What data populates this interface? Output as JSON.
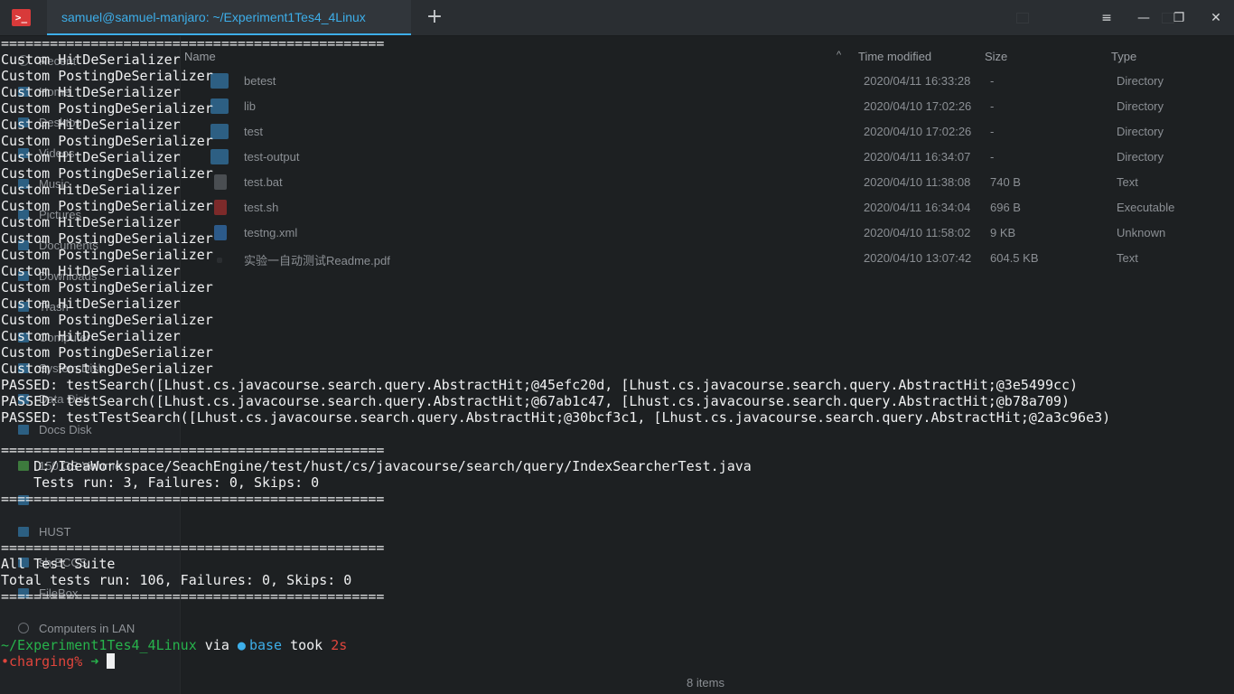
{
  "window": {
    "app_icon_glyph": ">_",
    "tab_title": "samuel@samuel-manjaro: ~/Experiment1Tes4_4Linux",
    "new_tab_glyph": "+",
    "menu_glyph": "≡",
    "minimize_glyph": "—",
    "maximize_glyph": "❐",
    "close_glyph": "✕",
    "accent_color": "#3daee9"
  },
  "file_manager": {
    "sidebar": [
      {
        "label": "Recent",
        "icon": "clock-icon"
      },
      {
        "label": "Home",
        "icon": "home-icon"
      },
      {
        "label": "Desktop",
        "icon": "folder-icon"
      },
      {
        "label": "Videos",
        "icon": "folder-icon"
      },
      {
        "label": "Music",
        "icon": "folder-icon"
      },
      {
        "label": "Pictures",
        "icon": "folder-icon"
      },
      {
        "label": "Documents",
        "icon": "folder-icon"
      },
      {
        "label": "Downloads",
        "icon": "folder-icon"
      },
      {
        "label": "Trash",
        "icon": "trash-icon"
      },
      {
        "label": "Computer",
        "icon": "computer-icon"
      },
      {
        "label": "System Disk",
        "icon": "disk-icon"
      },
      {
        "label": "Data Disk",
        "icon": "disk-icon"
      },
      {
        "label": "Docs Disk",
        "icon": "disk-icon"
      },
      {
        "label": "150 GB Volume",
        "icon": "drive-icon"
      },
      {
        "label": "",
        "icon": "folder-icon"
      },
      {
        "label": "HUST",
        "icon": "folder-icon"
      },
      {
        "label": "sh.ECCS",
        "icon": "folder-icon"
      },
      {
        "label": "FileBox",
        "icon": "folder-icon"
      },
      {
        "label": "Computers in LAN",
        "icon": "network-icon"
      }
    ],
    "columns": [
      "Name",
      "Time modified",
      "Size",
      "Type"
    ],
    "files": [
      {
        "name": "betest",
        "time": "2020/04/11 16:33:28",
        "size": "-",
        "type": "Directory",
        "icon": "folder-icon"
      },
      {
        "name": "lib",
        "time": "2020/04/10 17:02:26",
        "size": "-",
        "type": "Directory",
        "icon": "folder-icon"
      },
      {
        "name": "test",
        "time": "2020/04/10 17:02:26",
        "size": "-",
        "type": "Directory",
        "icon": "folder-icon"
      },
      {
        "name": "test-output",
        "time": "2020/04/11 16:34:07",
        "size": "-",
        "type": "Directory",
        "icon": "folder-icon"
      },
      {
        "name": "test.bat",
        "time": "2020/04/10 11:38:08",
        "size": "740 B",
        "type": "Text",
        "icon": "text-file-icon"
      },
      {
        "name": "test.sh",
        "time": "2020/04/11 16:34:04",
        "size": "696 B",
        "type": "Executable",
        "icon": "script-file-icon"
      },
      {
        "name": "testng.xml",
        "time": "2020/04/10 11:58:02",
        "size": "9 KB",
        "type": "Unknown",
        "icon": "xml-file-icon"
      },
      {
        "name": "实验一自动测试Readme.pdf",
        "time": "2020/04/10 13:07:42",
        "size": "604.5 KB",
        "type": "Text",
        "icon": "pdf-file-icon"
      }
    ],
    "status": "8 items"
  },
  "terminal": {
    "lines": [
      "===============================================",
      "Custom HitDeSerializer",
      "Custom PostingDeSerializer",
      "Custom HitDeSerializer",
      "Custom PostingDeSerializer",
      "Custom HitDeSerializer",
      "Custom PostingDeSerializer",
      "Custom HitDeSerializer",
      "Custom PostingDeSerializer",
      "Custom HitDeSerializer",
      "Custom PostingDeSerializer",
      "Custom HitDeSerializer",
      "Custom PostingDeSerializer",
      "Custom PostingDeSerializer",
      "Custom HitDeSerializer",
      "Custom PostingDeSerializer",
      "Custom HitDeSerializer",
      "Custom PostingDeSerializer",
      "Custom HitDeSerializer",
      "Custom PostingDeSerializer",
      "Custom PostingDeSerializer",
      "PASSED: testSearch([Lhust.cs.javacourse.search.query.AbstractHit;@45efc20d, [Lhust.cs.javacourse.search.query.AbstractHit;@3e5499cc)",
      "PASSED: testSearch([Lhust.cs.javacourse.search.query.AbstractHit;@67ab1c47, [Lhust.cs.javacourse.search.query.AbstractHit;@b78a709)",
      "PASSED: testTestSearch([Lhust.cs.javacourse.search.query.AbstractHit;@30bcf3c1, [Lhust.cs.javacourse.search.query.AbstractHit;@2a3c96e3)",
      "",
      "===============================================",
      "    D:/IdeaWorkspace/SeachEngine/test/hust/cs/javacourse/search/query/IndexSearcherTest.java",
      "    Tests run: 3, Failures: 0, Skips: 0",
      "===============================================",
      "",
      "",
      "===============================================",
      "All Test Suite",
      "Total tests run: 106, Failures: 0, Skips: 0",
      "===============================================",
      "",
      ""
    ],
    "prompt": {
      "path": "~/Experiment1Tes4_4Linux",
      "via": " via ",
      "conda_icon": "●",
      "env": "base",
      "took": " took ",
      "duration": "2s",
      "branch": "•charging%",
      "arrow": " ➜ "
    }
  }
}
